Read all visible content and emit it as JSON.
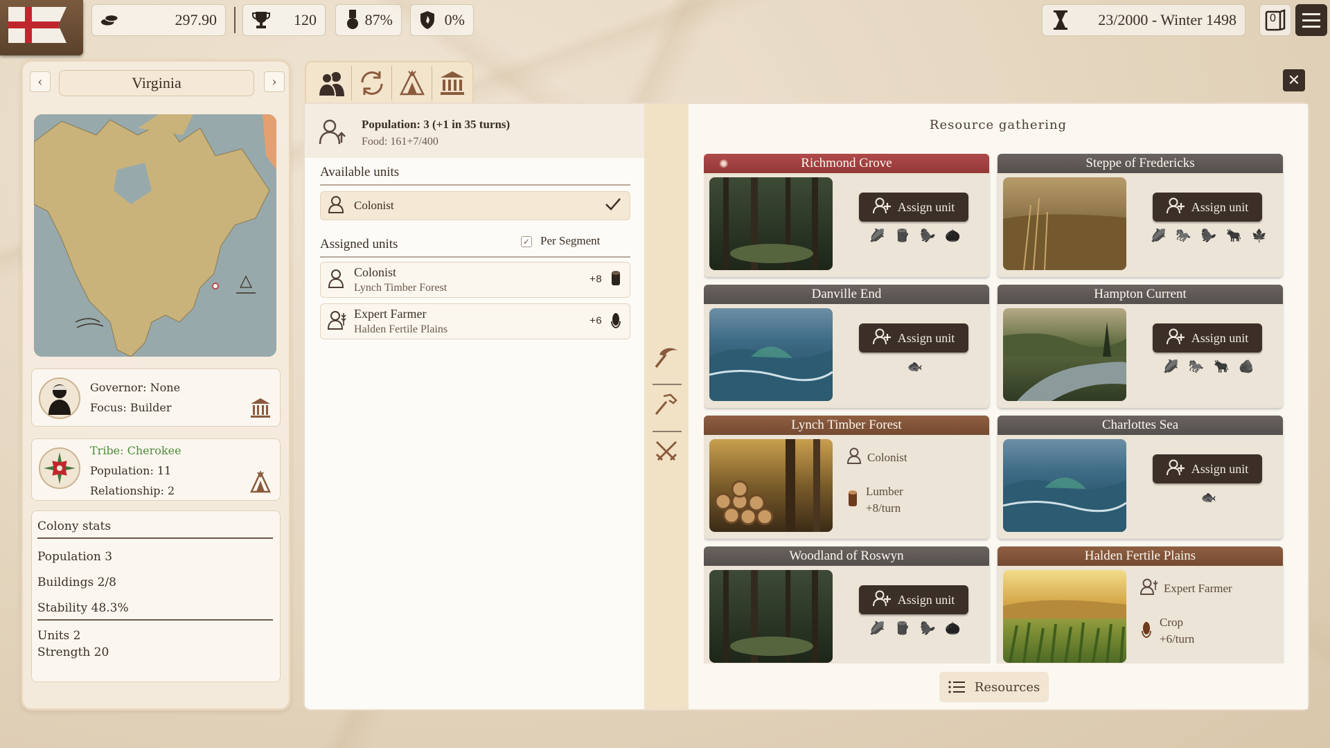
{
  "topbar": {
    "gold": "297.90",
    "prestige": "120",
    "health": "87%",
    "unrest": "0%",
    "turn_date": "23/2000 - Winter 1498",
    "log_count": "0"
  },
  "colony": {
    "name": "Virginia",
    "governor_label": "Governor: None",
    "focus_label": "Focus: Builder",
    "tribe_label": "Tribe: Cherokee",
    "tribe_population": "Population: 11",
    "tribe_relationship": "Relationship: 2",
    "stats": {
      "title": "Colony stats",
      "population": "Population 3",
      "buildings": "Buildings 2/8",
      "stability": "Stability 48.3%",
      "units": "Units 2",
      "strength": "Strength 20"
    }
  },
  "population_panel": {
    "title": "Population: 3 (+1 in 35 turns)",
    "food": "Food: 161+7/400",
    "available_title": "Available units",
    "available_units": [
      {
        "name": "Colonist"
      }
    ],
    "assigned_title": "Assigned units",
    "per_segment_label": "Per Segment",
    "assigned_units": [
      {
        "name": "Colonist",
        "location": "Lynch Timber Forest",
        "value": "+8",
        "icon": "lumber-icon"
      },
      {
        "name": "Expert Farmer",
        "location": "Halden Fertile Plains",
        "value": "+6",
        "icon": "crop-icon"
      }
    ]
  },
  "resource_gathering": {
    "title": "Resource gathering",
    "assign_label": "Assign unit",
    "resources_button": "Resources",
    "tiles": [
      {
        "name": "Richmond Grove",
        "header": "red",
        "scene": "forest",
        "state": "empty",
        "icons": [
          "🌽",
          "🪵",
          "🦫",
          "🌰"
        ]
      },
      {
        "name": "Steppe of Fredericks",
        "header": "grey",
        "scene": "steppe",
        "state": "empty",
        "icons": [
          "🌽",
          "🐎",
          "🦫",
          "🐂",
          "🍁"
        ]
      },
      {
        "name": "Danville End",
        "header": "grey",
        "scene": "sea",
        "state": "empty",
        "icons": [
          "🐟"
        ]
      },
      {
        "name": "Hampton Current",
        "header": "grey",
        "scene": "river",
        "state": "empty",
        "icons": [
          "🌽",
          "🐎",
          "🐂",
          "🪨"
        ]
      },
      {
        "name": "Lynch Timber Forest",
        "header": "brown",
        "scene": "timber",
        "state": "assigned",
        "unit": "Colonist",
        "resource": "Lumber",
        "rate": "+8/turn"
      },
      {
        "name": "Charlottes Sea",
        "header": "grey",
        "scene": "sea",
        "state": "empty",
        "icons": [
          "🐟"
        ]
      },
      {
        "name": "Woodland of Roswyn",
        "header": "grey",
        "scene": "forest",
        "state": "empty",
        "icons": [
          "🌽",
          "🪵",
          "🦫",
          "🌰"
        ]
      },
      {
        "name": "Halden Fertile Plains",
        "header": "brown",
        "scene": "plains",
        "state": "assigned",
        "unit": "Expert Farmer",
        "resource": "Crop",
        "rate": "+6/turn"
      }
    ]
  },
  "colors": {
    "accent_dark": "#3c2f28",
    "header_red": "#a04242",
    "header_brown": "#80543a",
    "header_grey": "#5f5956",
    "tribe_green": "#4e8a3a"
  }
}
